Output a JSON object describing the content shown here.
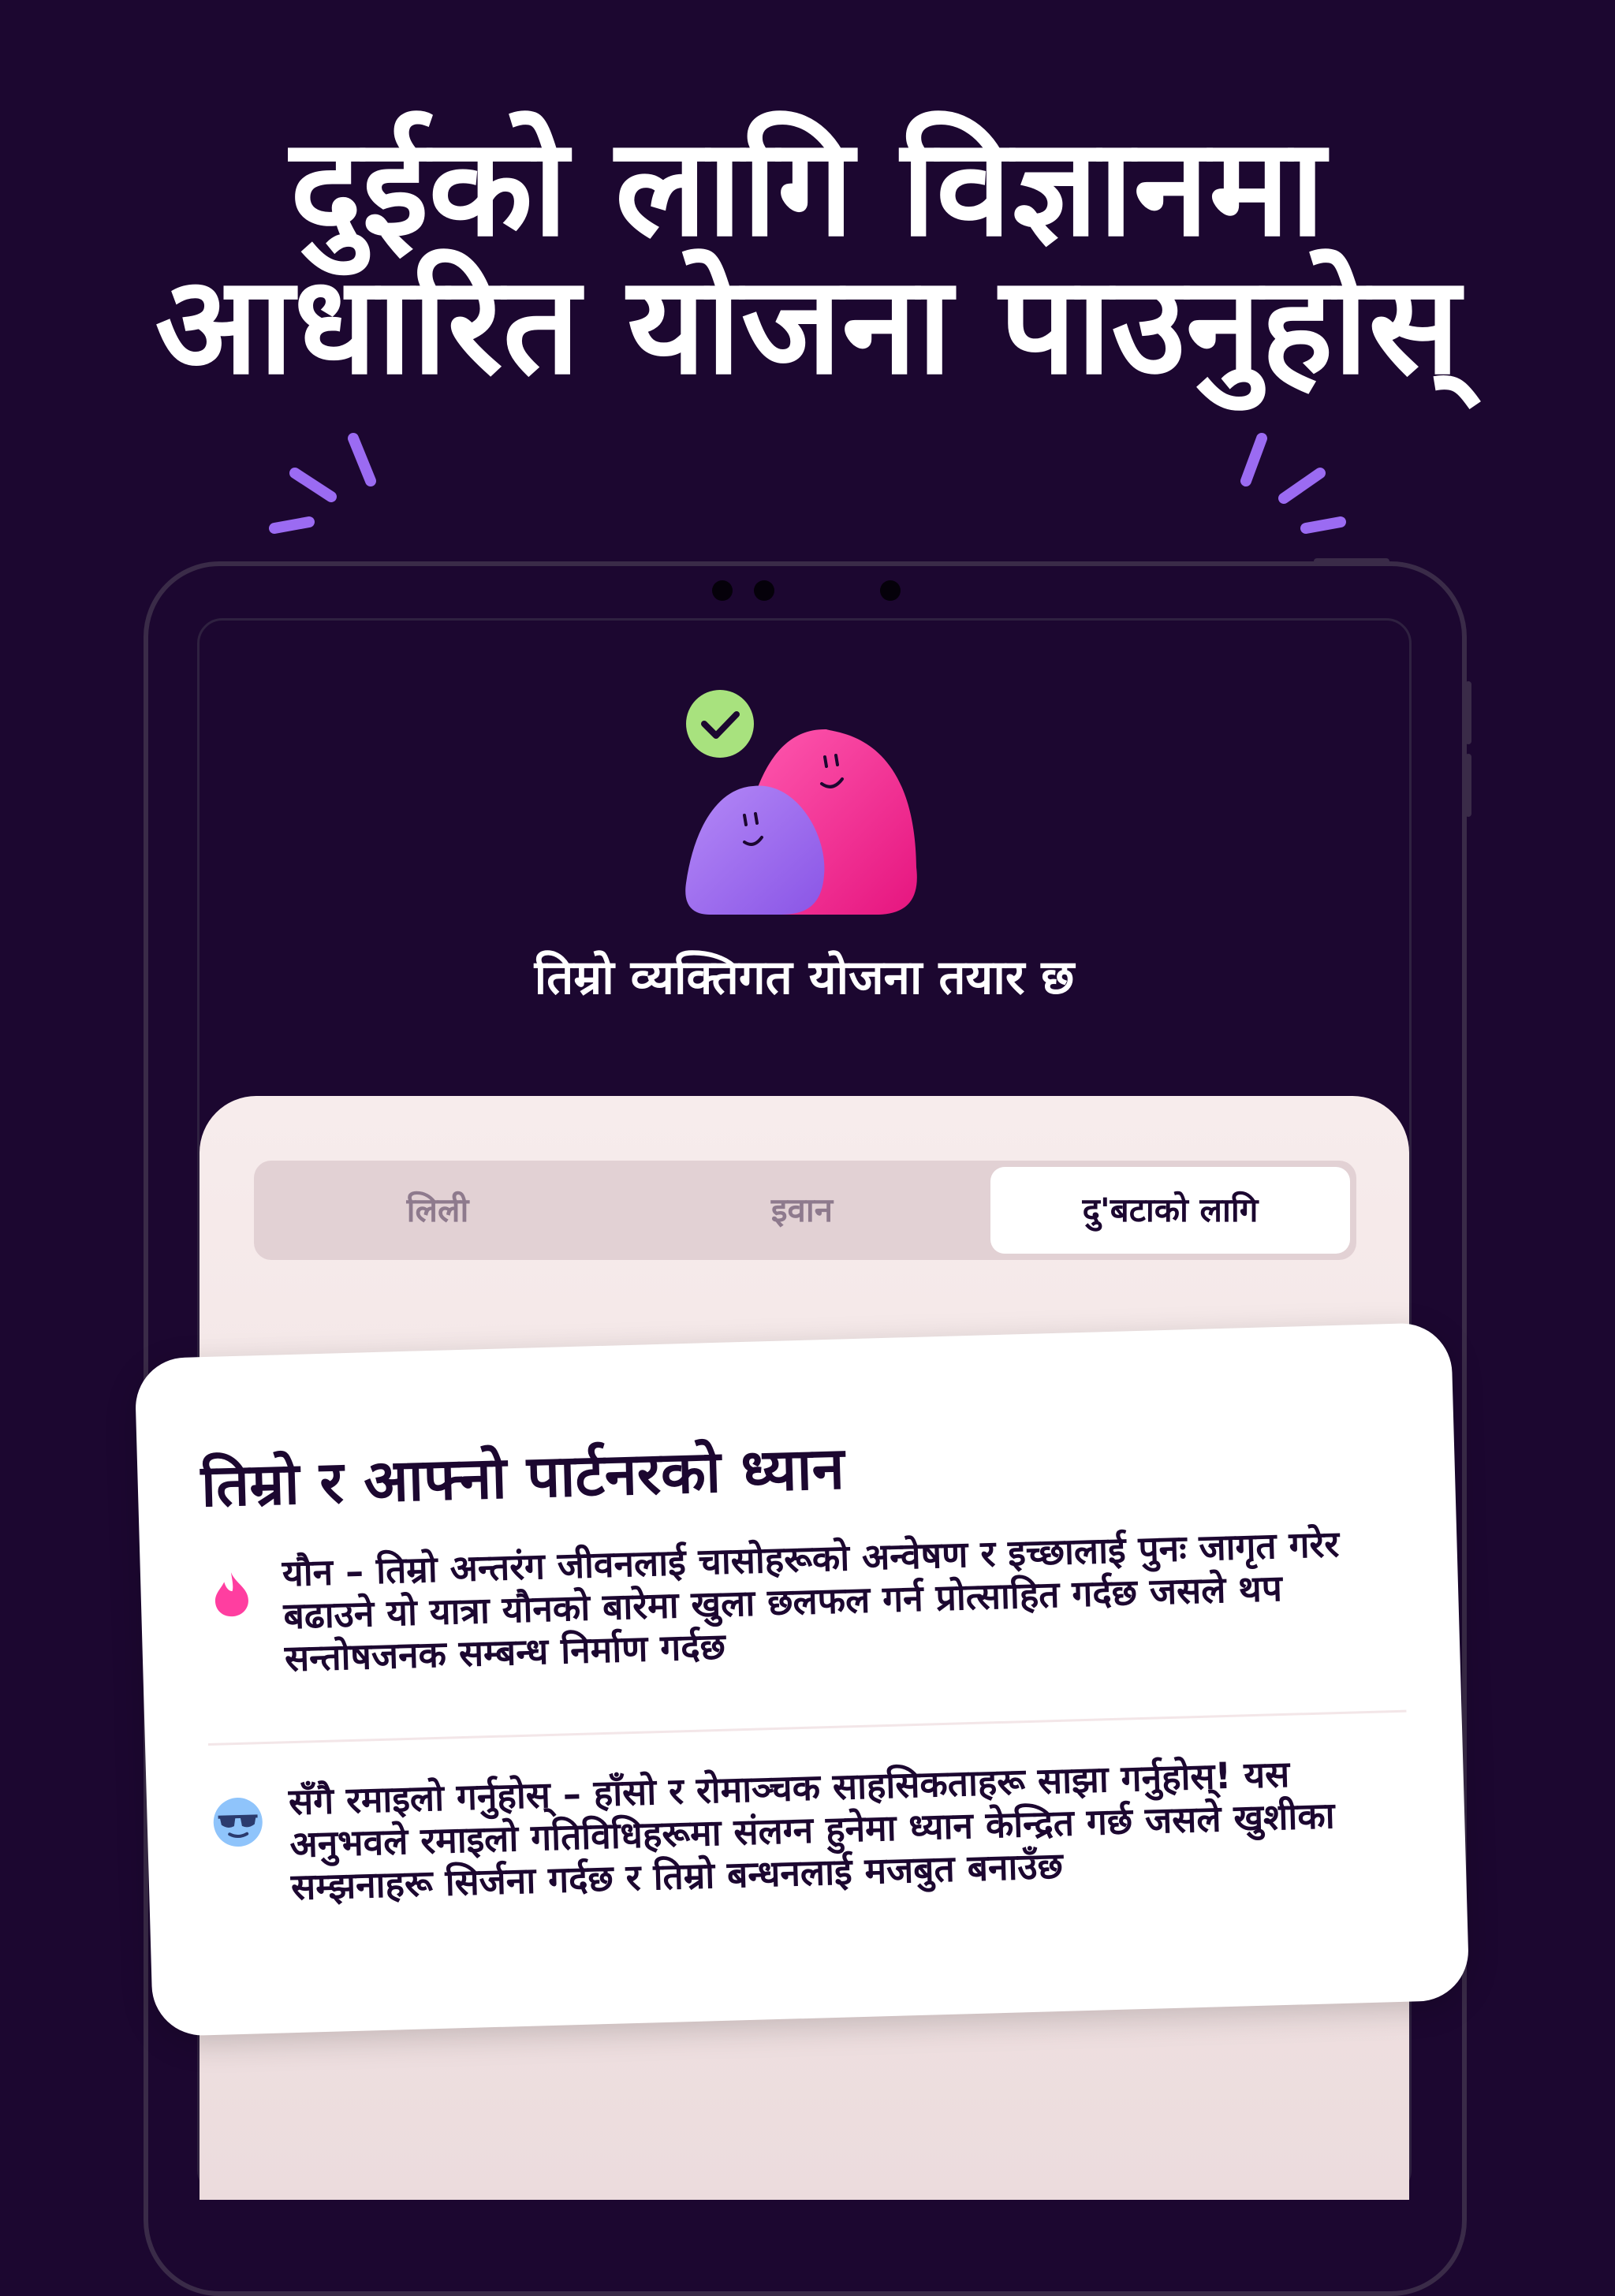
{
  "headline": {
    "line1": "दुईको लागि विज्ञानमा",
    "line2": "आधारित योजना पाउनुहोस्"
  },
  "screen": {
    "plan_ready_title": "तिम्रो व्यक्तिगत योजना तयार छ",
    "tabs": [
      {
        "label": "लिली",
        "active": false
      },
      {
        "label": "इवान",
        "active": false
      },
      {
        "label": "दु'बटाको लागि",
        "active": true
      }
    ]
  },
  "card": {
    "title": "तिम्रो र आफ्नो पार्टनरको ध्यान",
    "items": [
      {
        "icon": "flame-icon",
        "text": "यौन – तिम्रो अन्तरंग जीवनलाई चासोहरूको अन्वेषण र इच्छालाई पुनः जागृत गरेर बढाउने  यो यात्रा यौनको बारेमा खुला छलफल गर्न प्रोत्साहित गर्दछ जसले थप सन्तोषजनक सम्बन्ध निर्माण गर्दछ"
      },
      {
        "icon": "sunglasses-face-icon",
        "text": "सँगै रमाइलो गर्नुहोस् – हाँसो र रोमाञ्चक साहसिकताहरू साझा गर्नुहोस्! यस अनुभवले रमाइलो गतिविधिहरूमा संलग्न हुनेमा ध्यान केन्द्रित गर्छ जसले खुशीका सम्झनाहरू सिर्जना गर्दछ र तिम्रो बन्धनलाई मजबुत बनाउँछ"
      }
    ]
  },
  "colors": {
    "background": "#1c0730",
    "accent_purple": "#9b6bf2",
    "accent_pink": "#ff3ea0",
    "check_green": "#a8e27e"
  }
}
